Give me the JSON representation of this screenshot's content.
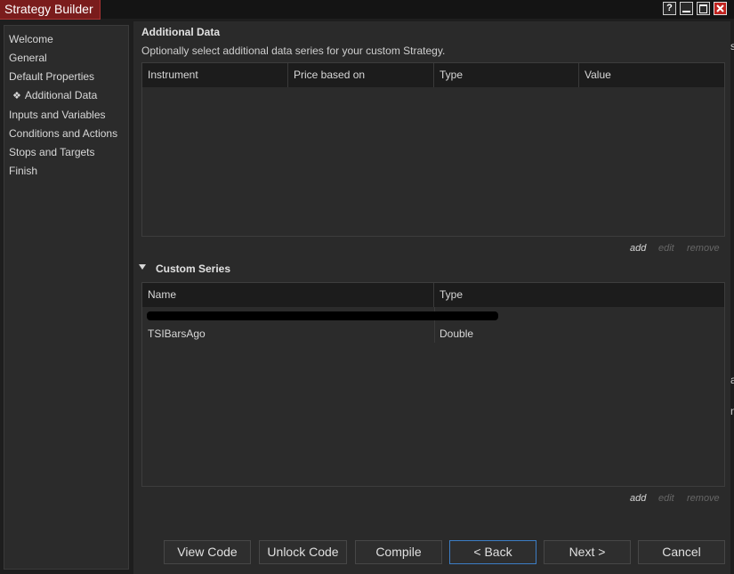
{
  "window": {
    "title": "Strategy Builder",
    "help": "?",
    "minimize": "—",
    "maximize": "□",
    "close": "✕"
  },
  "sidebar": {
    "items": [
      {
        "label": "Welcome"
      },
      {
        "label": "General"
      },
      {
        "label": "Default Properties"
      },
      {
        "label": "Additional Data",
        "marker": "❖"
      },
      {
        "label": "Inputs and Variables"
      },
      {
        "label": "Conditions and Actions"
      },
      {
        "label": "Stops and Targets"
      },
      {
        "label": "Finish"
      }
    ]
  },
  "additional_data": {
    "title": "Additional Data",
    "description": "Optionally select additional data series for your custom Strategy.",
    "columns": [
      "Instrument",
      "Price based on",
      "Type",
      "Value"
    ],
    "actions": {
      "add": "add",
      "edit": "edit",
      "remove": "remove"
    }
  },
  "custom_series": {
    "title": "Custom Series",
    "columns": [
      "Name",
      "Type"
    ],
    "rows": [
      {
        "name": "",
        "type": ""
      },
      {
        "name": "TSIBarsAgo",
        "type": "Double"
      }
    ],
    "actions": {
      "add": "add",
      "edit": "edit",
      "remove": "remove"
    }
  },
  "buttons": {
    "view_code": "View Code",
    "unlock_code": "Unlock Code",
    "compile": "Compile",
    "back": "< Back",
    "next": "Next >",
    "cancel": "Cancel"
  },
  "edge_glyphs": [
    "s",
    "a",
    "n"
  ]
}
